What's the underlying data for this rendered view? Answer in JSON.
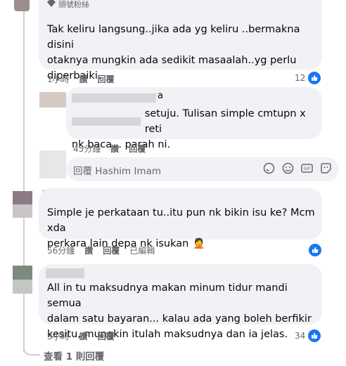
{
  "comments": [
    {
      "id": "c1",
      "badge": "頭號粉絲",
      "text_lines": [
        "Tak keliru langsung..jika ada yg keliru ..bermakna disini",
        "otaknya mungkin ada sedikit masaalah..yg perlu",
        "diperbaiki."
      ],
      "meta": {
        "time": "1小時",
        "like": "讚",
        "reply": "回覆"
      },
      "likes": "12"
    },
    {
      "id": "c2",
      "name_tail": "a",
      "text_line1_tail": "setuju. Tulisan simple cmtupn x reti",
      "text_line2": "nk baca... parah ni.",
      "meta": {
        "time": "45分鐘",
        "like": "讚",
        "reply": "回覆"
      }
    },
    {
      "id": "c3",
      "text_lines": [
        "Simple je perkataan tu..itu pun nk bikin isu ke? Mcm xda",
        "perkara lain depa nk isukan"
      ],
      "emoji": "🤦",
      "meta": {
        "time": "56分鐘",
        "like": "讚",
        "reply": "回覆",
        "edited": "已編輯"
      }
    },
    {
      "id": "c4",
      "text_lines": [
        "All in tu maksudnya makan minum tidur mandi semua",
        "dalam satu bayaran... kalau ada yang boleh berfikir",
        "kesitu, mungkin itulah maksudnya dan ia jelas."
      ],
      "meta": {
        "time": "3小時",
        "like": "讚",
        "reply": "回覆"
      },
      "likes": "34"
    }
  ],
  "reply_input": {
    "placeholder": "回覆 Hashim Imam"
  },
  "view_replies": "查看 1 則回覆",
  "colors": {
    "like_blue": "#1877f2",
    "bubble": "#f0f2f5",
    "meta": "#65676b"
  },
  "icons": [
    "sticker-icon",
    "emoji-icon",
    "gif-icon",
    "sticker-alt-icon",
    "like-icon",
    "diamond-icon"
  ]
}
